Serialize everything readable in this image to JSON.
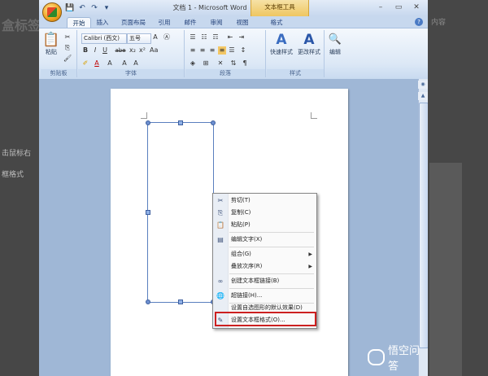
{
  "background": {
    "left_text_top": "盒标签",
    "left_text_middle": "击鼠标右",
    "left_text_bottom": "框格式",
    "right_text": "内容"
  },
  "window": {
    "title": "文档 1 - Microsoft Word",
    "contextual_tool": "文本框工具",
    "controls": {
      "minimize": "–",
      "restore": "▭",
      "close": "✕"
    }
  },
  "quick_access": {
    "save": "💾",
    "undo": "↶",
    "redo": "↷",
    "customize": "▾"
  },
  "tabs": [
    "开始",
    "插入",
    "页面布局",
    "引用",
    "邮件",
    "审阅",
    "视图",
    "格式"
  ],
  "help": "?",
  "ribbon": {
    "clipboard": {
      "paste_label": "粘贴",
      "group_label": "剪贴板"
    },
    "font": {
      "font_name": "Calibri (西文)",
      "font_size": "五号",
      "group_label": "字体",
      "buttons": [
        "B",
        "I",
        "U",
        "abe",
        "x₂",
        "x²",
        "Aa",
        "A",
        "A",
        "A",
        "A"
      ]
    },
    "paragraph": {
      "group_label": "段落"
    },
    "styles": {
      "quick_styles": "快速样式",
      "change_styles": "更改样式",
      "group_label": "样式"
    },
    "editing": {
      "label": "编辑"
    }
  },
  "context_menu": {
    "items": [
      {
        "icon": "✂",
        "label": "剪切(T)",
        "submenu": false
      },
      {
        "icon": "⎘",
        "label": "复制(C)",
        "submenu": false
      },
      {
        "icon": "📋",
        "label": "粘贴(P)",
        "submenu": false
      },
      {
        "icon": "▤",
        "label": "编辑文字(X)",
        "submenu": false
      },
      {
        "icon": "",
        "label": "组合(G)",
        "submenu": true
      },
      {
        "icon": "",
        "label": "叠放次序(R)",
        "submenu": true
      },
      {
        "icon": "∞",
        "label": "创建文本框链接(B)",
        "submenu": false
      },
      {
        "icon": "🌐",
        "label": "超链接(H)...",
        "submenu": false
      },
      {
        "icon": "",
        "label": "设置自选图形的默认效果(D)",
        "submenu": false
      },
      {
        "icon": "✎",
        "label": "设置文本框格式(O)...",
        "submenu": false
      }
    ],
    "highlighted_item": "设置文本框格式(O)...",
    "highlight_color": "#cc2020"
  },
  "watermark": {
    "text": "悟空问答"
  }
}
